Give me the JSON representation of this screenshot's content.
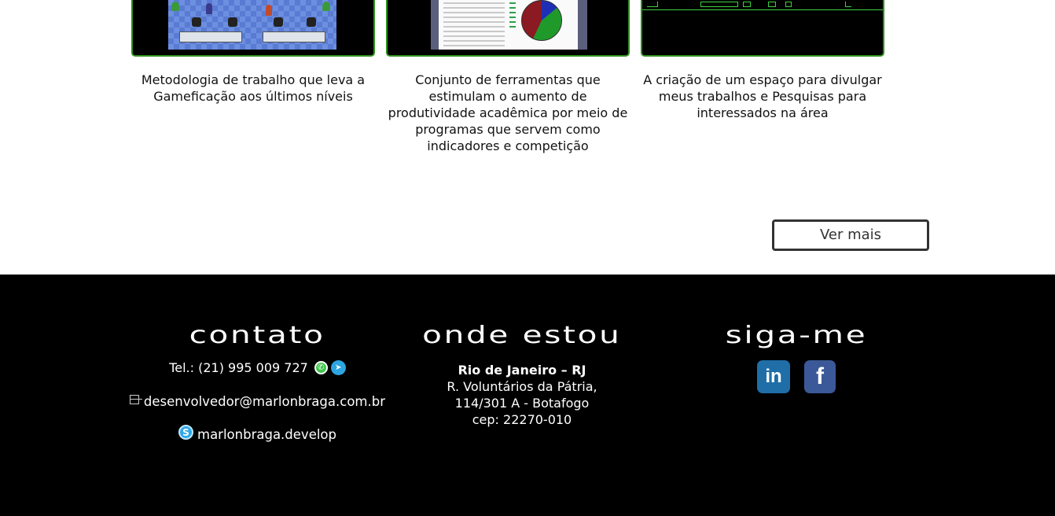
{
  "cards": [
    {
      "description": "Metodologia de trabalho que leva a Gameficação aos últimos níveis"
    },
    {
      "description": "Conjunto de ferramentas que estimulam o aumento de produtividade acadêmica por meio de programas que servem como indicadores e competição"
    },
    {
      "description": "A criação de um espaço para divulgar meus trabalhos e Pesquisas para interessados na área"
    }
  ],
  "ver_mais_label": "Ver mais",
  "footer": {
    "contato": {
      "title": "contato",
      "tel": "Tel.: (21) 995 009 727",
      "email": "desenvolvedor@marlonbraga.com.br",
      "skype": "marlonbraga.develop",
      "icons": [
        "whatsapp-icon",
        "telegram-icon",
        "mail-icon",
        "skype-icon"
      ]
    },
    "onde_estou": {
      "title": "onde estou",
      "city": "Rio de Janeiro – RJ",
      "street": "R. Voluntários da Pátria,",
      "number": "114/301 A - Botafogo",
      "cep": "cep: 22270-010"
    },
    "siga_me": {
      "title": "siga-me",
      "linkedin_glyph": "in",
      "facebook_glyph": "f"
    }
  },
  "colors": {
    "thumb_border": "#2f8f1e",
    "footer_bg": "#000000",
    "button_border": "#333333"
  }
}
